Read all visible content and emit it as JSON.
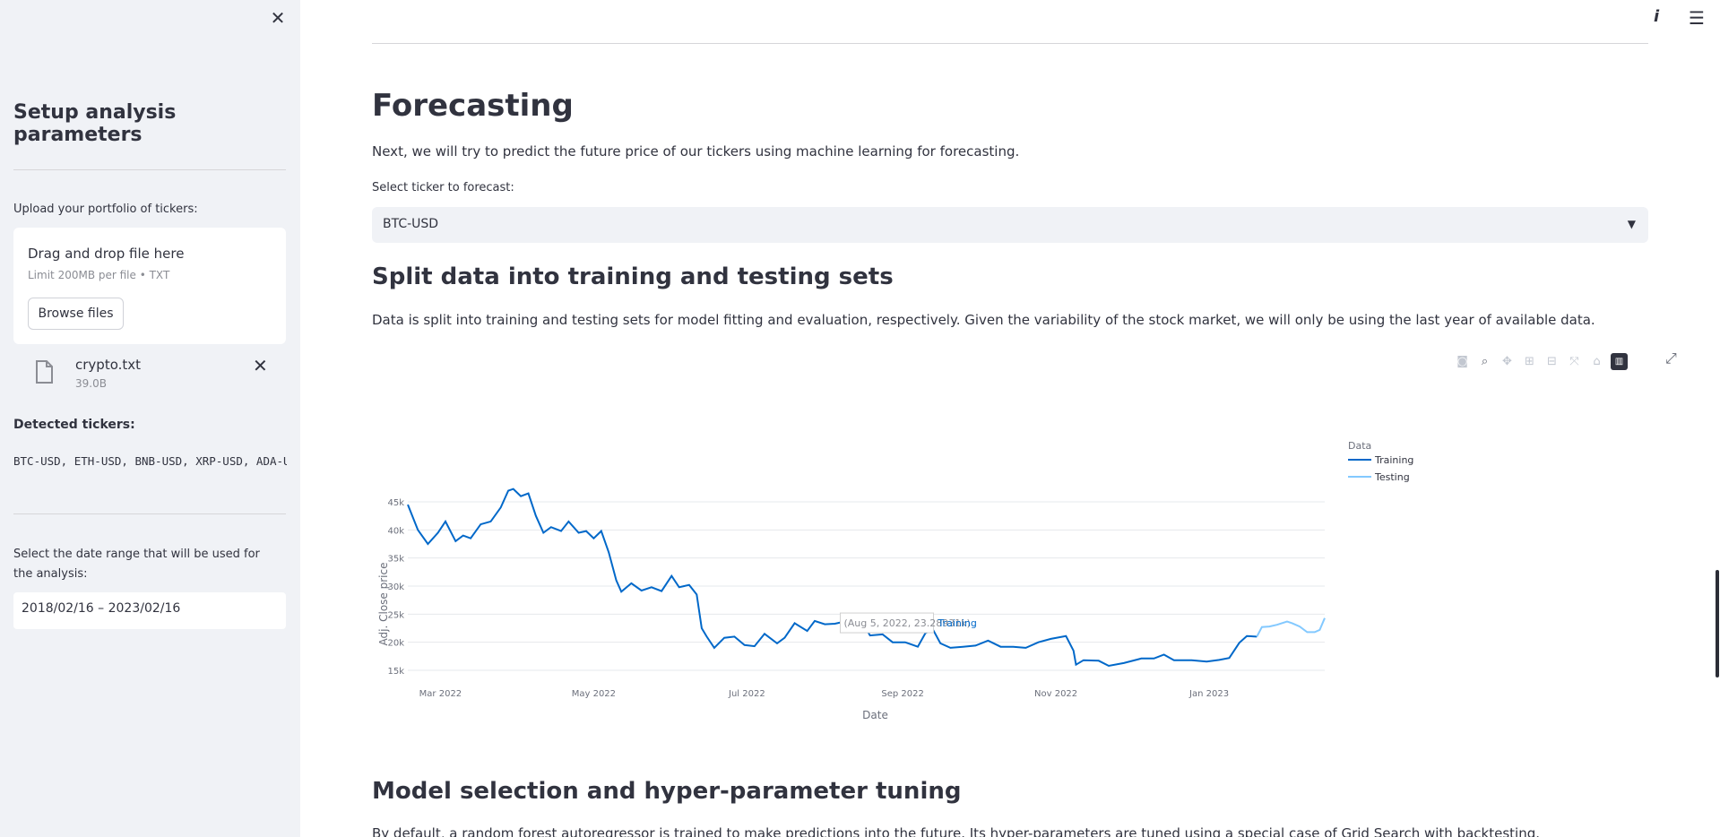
{
  "sidebar": {
    "title": "Setup analysis parameters",
    "upload_label": "Upload your portfolio of tickers:",
    "uploader": {
      "title": "Drag and drop file here",
      "limit": "Limit 200MB per file • TXT",
      "browse_label": "Browse files"
    },
    "file": {
      "name": "crypto.txt",
      "size": "39.0B"
    },
    "detected_label": "Detected tickers:",
    "tickers": "BTC-USD, ETH-USD, BNB-USD, XRP-USD, ADA-USD",
    "date_label": "Select the date range that will be used for the analysis:",
    "date_value": "2018/02/16 – 2023/02/16"
  },
  "main": {
    "forecast_title": "Forecasting",
    "forecast_text": "Next, we will try to predict the future price of our tickers using machine learning for forecasting.",
    "select_label": "Select ticker to forecast:",
    "select_value": "BTC-USD",
    "split_title": "Split data into training and testing sets",
    "split_text": "Data is split into training and testing sets for model fitting and evaluation, respectively. Given the variability of the stock market, we will only be using the last year of available data.",
    "model_title": "Model selection and hyper-parameter tuning",
    "model_text": "By default, a random forest autoregressor is trained to make predictions into the future. Its hyper-parameters are tuned using a special case of Grid Search with backtesting."
  },
  "icons": {
    "close": "close-icon",
    "info": "info-icon",
    "menu": "menu-icon",
    "file": "file-icon",
    "modebar": [
      "camera-icon",
      "zoom-icon",
      "pan-icon",
      "zoom-in-icon",
      "zoom-out-icon",
      "autoscale-icon",
      "home-icon",
      "plotly-logo-icon"
    ],
    "expand": "expand-icon"
  },
  "colors": {
    "training": "#0068c9",
    "testing": "#83c9ff",
    "sidebar_bg": "#f0f2f6",
    "text": "#31333f"
  },
  "chart_data": {
    "type": "line",
    "xlabel": "Date",
    "ylabel": "Adj. Close price",
    "x_ticks": [
      "Mar 2022",
      "May 2022",
      "Jul 2022",
      "Sep 2022",
      "Nov 2022",
      "Jan 2023"
    ],
    "y_ticks": [
      "15k",
      "20k",
      "25k",
      "30k",
      "35k",
      "40k",
      "45k"
    ],
    "ylim": [
      15000,
      45000
    ],
    "xlim": [
      "2022-02-16",
      "2023-02-16"
    ],
    "legend_title": "Data",
    "legend_position": "top-right",
    "grid": true,
    "tooltip": {
      "text": "(Aug 5, 2022, 23.28931k)",
      "series": "Training",
      "x": "2022-08-05",
      "y": 23289.31
    },
    "series": [
      {
        "name": "Training",
        "color": "#0068c9",
        "points": [
          [
            "2022-02-16",
            44500
          ],
          [
            "2022-02-20",
            40000
          ],
          [
            "2022-02-24",
            37500
          ],
          [
            "2022-02-28",
            39500
          ],
          [
            "2022-03-03",
            41500
          ],
          [
            "2022-03-07",
            38000
          ],
          [
            "2022-03-10",
            39000
          ],
          [
            "2022-03-13",
            38500
          ],
          [
            "2022-03-17",
            41000
          ],
          [
            "2022-03-21",
            41500
          ],
          [
            "2022-03-25",
            44000
          ],
          [
            "2022-03-28",
            47000
          ],
          [
            "2022-03-30",
            47300
          ],
          [
            "2022-04-02",
            46000
          ],
          [
            "2022-04-05",
            46500
          ],
          [
            "2022-04-08",
            42500
          ],
          [
            "2022-04-11",
            39500
          ],
          [
            "2022-04-14",
            40500
          ],
          [
            "2022-04-18",
            39800
          ],
          [
            "2022-04-21",
            41500
          ],
          [
            "2022-04-25",
            39500
          ],
          [
            "2022-04-28",
            39800
          ],
          [
            "2022-05-01",
            38500
          ],
          [
            "2022-05-04",
            39800
          ],
          [
            "2022-05-07",
            36000
          ],
          [
            "2022-05-10",
            31000
          ],
          [
            "2022-05-12",
            29000
          ],
          [
            "2022-05-16",
            30500
          ],
          [
            "2022-05-20",
            29200
          ],
          [
            "2022-05-24",
            29800
          ],
          [
            "2022-05-28",
            29100
          ],
          [
            "2022-06-01",
            31800
          ],
          [
            "2022-06-04",
            29800
          ],
          [
            "2022-06-08",
            30200
          ],
          [
            "2022-06-11",
            28500
          ],
          [
            "2022-06-13",
            22500
          ],
          [
            "2022-06-15",
            21000
          ],
          [
            "2022-06-18",
            19000
          ],
          [
            "2022-06-22",
            20800
          ],
          [
            "2022-06-26",
            21000
          ],
          [
            "2022-06-30",
            19500
          ],
          [
            "2022-07-04",
            19300
          ],
          [
            "2022-07-08",
            21500
          ],
          [
            "2022-07-13",
            19800
          ],
          [
            "2022-07-16",
            20800
          ],
          [
            "2022-07-20",
            23400
          ],
          [
            "2022-07-25",
            22000
          ],
          [
            "2022-07-28",
            23800
          ],
          [
            "2022-08-01",
            23200
          ],
          [
            "2022-08-05",
            23290
          ],
          [
            "2022-08-10",
            23800
          ],
          [
            "2022-08-15",
            24200
          ],
          [
            "2022-08-19",
            21200
          ],
          [
            "2022-08-24",
            21400
          ],
          [
            "2022-08-28",
            20000
          ],
          [
            "2022-09-02",
            20000
          ],
          [
            "2022-09-07",
            19200
          ],
          [
            "2022-09-10",
            21600
          ],
          [
            "2022-09-13",
            22300
          ],
          [
            "2022-09-16",
            19800
          ],
          [
            "2022-09-20",
            19000
          ],
          [
            "2022-09-25",
            19200
          ],
          [
            "2022-09-30",
            19400
          ],
          [
            "2022-10-05",
            20300
          ],
          [
            "2022-10-10",
            19200
          ],
          [
            "2022-10-15",
            19200
          ],
          [
            "2022-10-20",
            19000
          ],
          [
            "2022-10-25",
            20000
          ],
          [
            "2022-10-30",
            20600
          ],
          [
            "2022-11-05",
            21100
          ],
          [
            "2022-11-08",
            18500
          ],
          [
            "2022-11-09",
            16000
          ],
          [
            "2022-11-12",
            16800
          ],
          [
            "2022-11-18",
            16700
          ],
          [
            "2022-11-22",
            15800
          ],
          [
            "2022-11-28",
            16300
          ],
          [
            "2022-12-05",
            17100
          ],
          [
            "2022-12-10",
            17100
          ],
          [
            "2022-12-14",
            17800
          ],
          [
            "2022-12-18",
            16800
          ],
          [
            "2022-12-25",
            16800
          ],
          [
            "2022-12-31",
            16550
          ],
          [
            "2023-01-05",
            16850
          ],
          [
            "2023-01-09",
            17200
          ],
          [
            "2023-01-13",
            19900
          ],
          [
            "2023-01-16",
            21100
          ],
          [
            "2023-01-20",
            21000
          ]
        ]
      },
      {
        "name": "Testing",
        "color": "#83c9ff",
        "points": [
          [
            "2023-01-20",
            21000
          ],
          [
            "2023-01-22",
            22700
          ],
          [
            "2023-01-25",
            22800
          ],
          [
            "2023-01-28",
            23100
          ],
          [
            "2023-02-01",
            23700
          ],
          [
            "2023-02-03",
            23400
          ],
          [
            "2023-02-06",
            22800
          ],
          [
            "2023-02-09",
            21800
          ],
          [
            "2023-02-12",
            21800
          ],
          [
            "2023-02-14",
            22200
          ],
          [
            "2023-02-16",
            24300
          ]
        ]
      }
    ]
  }
}
